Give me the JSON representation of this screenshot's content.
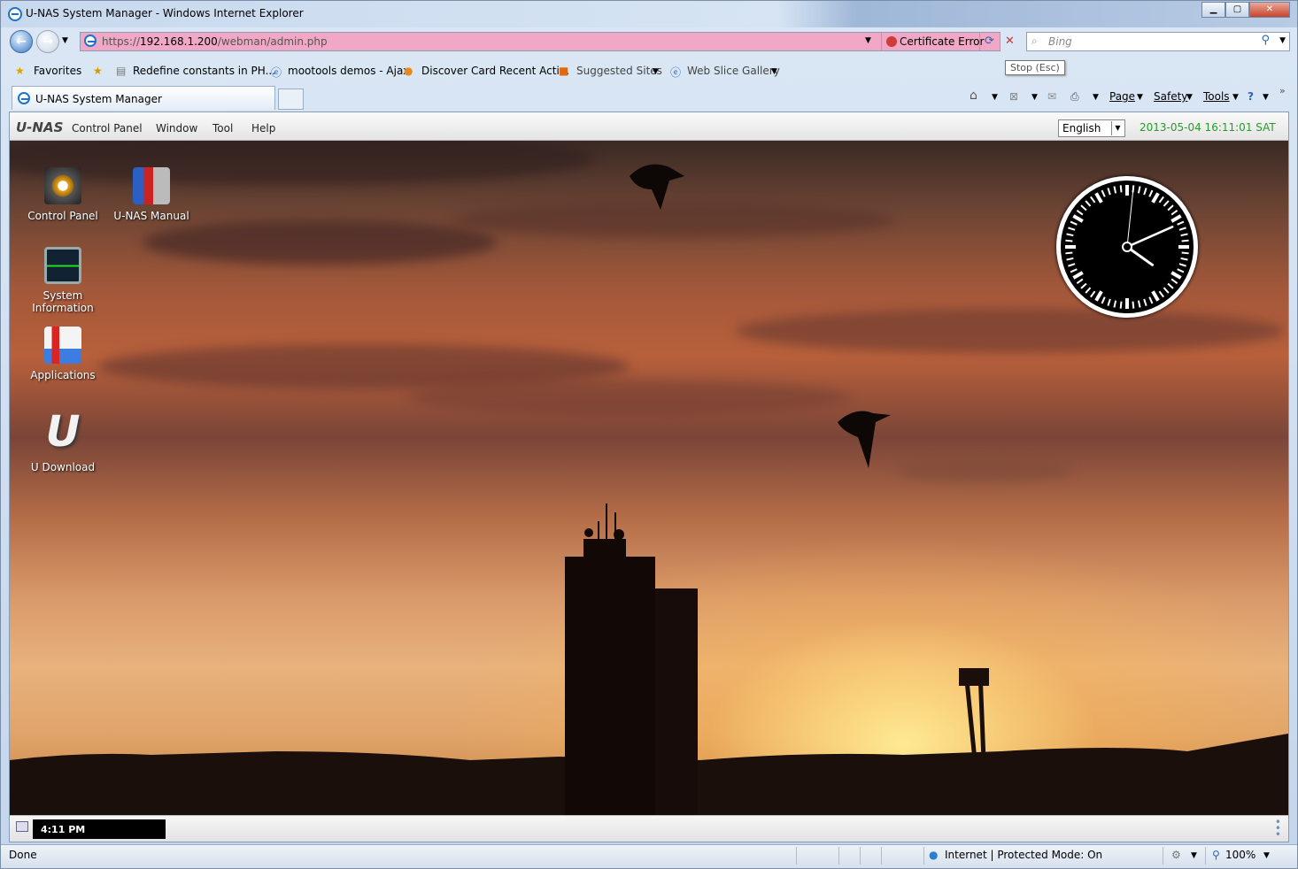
{
  "window": {
    "title": "U-NAS System Manager - Windows Internet Explorer"
  },
  "address": {
    "url_prefix": "https://",
    "url_host": "192.168.1.200",
    "url_path": "/webman/admin.php",
    "cert_error": "Certificate Error"
  },
  "search": {
    "placeholder": "Bing"
  },
  "favorites": {
    "label": "Favorites",
    "items": [
      "Redefine constants in PH...",
      "mootools demos - Ajax",
      "Discover Card Recent Acti...",
      "Suggested Sites",
      "Web Slice Gallery"
    ]
  },
  "tooltip": "Stop (Esc)",
  "tab": {
    "label": "U-NAS System Manager"
  },
  "commandbar": {
    "page": "Page",
    "safety": "Safety",
    "tools": "Tools"
  },
  "app": {
    "logo": "U-NAS",
    "menu": [
      "Control Panel",
      "Window",
      "Tool",
      "Help"
    ],
    "language": "English",
    "datetime": "2013-05-04 16:11:01 SAT"
  },
  "desktop_icons": [
    {
      "label": "Control Panel",
      "icon": "gear-icon"
    },
    {
      "label": "U-NAS Manual",
      "icon": "books-icon"
    },
    {
      "label": "System Information",
      "icon": "monitor-icon"
    },
    {
      "label": "Applications",
      "icon": "blocks-icon"
    },
    {
      "label": "U Download",
      "icon": "u-logo-icon"
    }
  ],
  "clock": {
    "hour": 4,
    "minute": 11,
    "second": 1
  },
  "taskbar": {
    "time": "4:11 PM"
  },
  "statusbar": {
    "status": "Done",
    "zone": "Internet | Protected Mode: On",
    "zoom": "100%"
  }
}
